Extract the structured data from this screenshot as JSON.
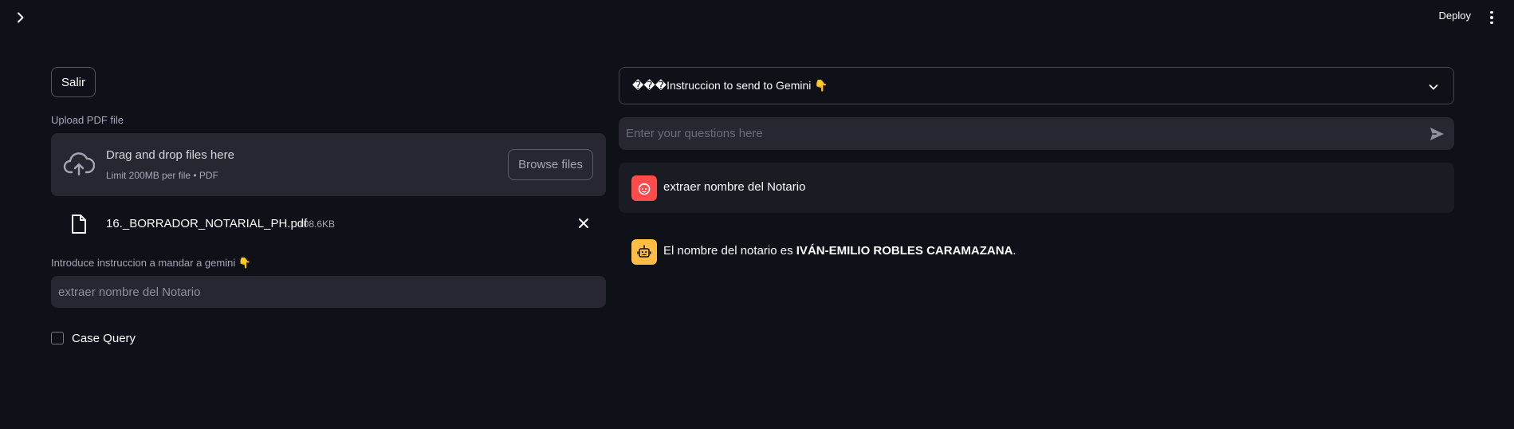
{
  "header": {
    "deploy_label": "Deploy",
    "sidebar_toggle_icon": "chevron-right-icon",
    "menu_icon": "kebab-menu-icon"
  },
  "left": {
    "logout_button": "Salir",
    "upload_label": "Upload PDF file",
    "dropzone": {
      "title": "Drag and drop files here",
      "subtitle": "Limit 200MB per file • PDF",
      "browse_button": "Browse files"
    },
    "uploaded_file": {
      "name": "16._BORRADOR_NOTARIAL_PH.pdf",
      "size": "108.6KB"
    },
    "instruction_label": "Introduce instruccion a mandar a gemini 👇",
    "instruction_value": "extraer nombre del Notario",
    "checkbox_label": "Case Query"
  },
  "right": {
    "expander_title": "���Instruccion to send to Gemini 👇",
    "chat_placeholder": "Enter your questions here",
    "messages": [
      {
        "role": "user",
        "text": "extraer nombre del Notario"
      },
      {
        "role": "assistant",
        "text_prefix": "El nombre del notario es ",
        "text_bold": "IVÁN-EMILIO ROBLES CARAMAZANA",
        "text_suffix": "."
      }
    ]
  },
  "colors": {
    "background": "#0e1117",
    "input_bg": "#262730",
    "user_avatar": "#ff4b4b",
    "bot_avatar": "#ffbd45"
  }
}
